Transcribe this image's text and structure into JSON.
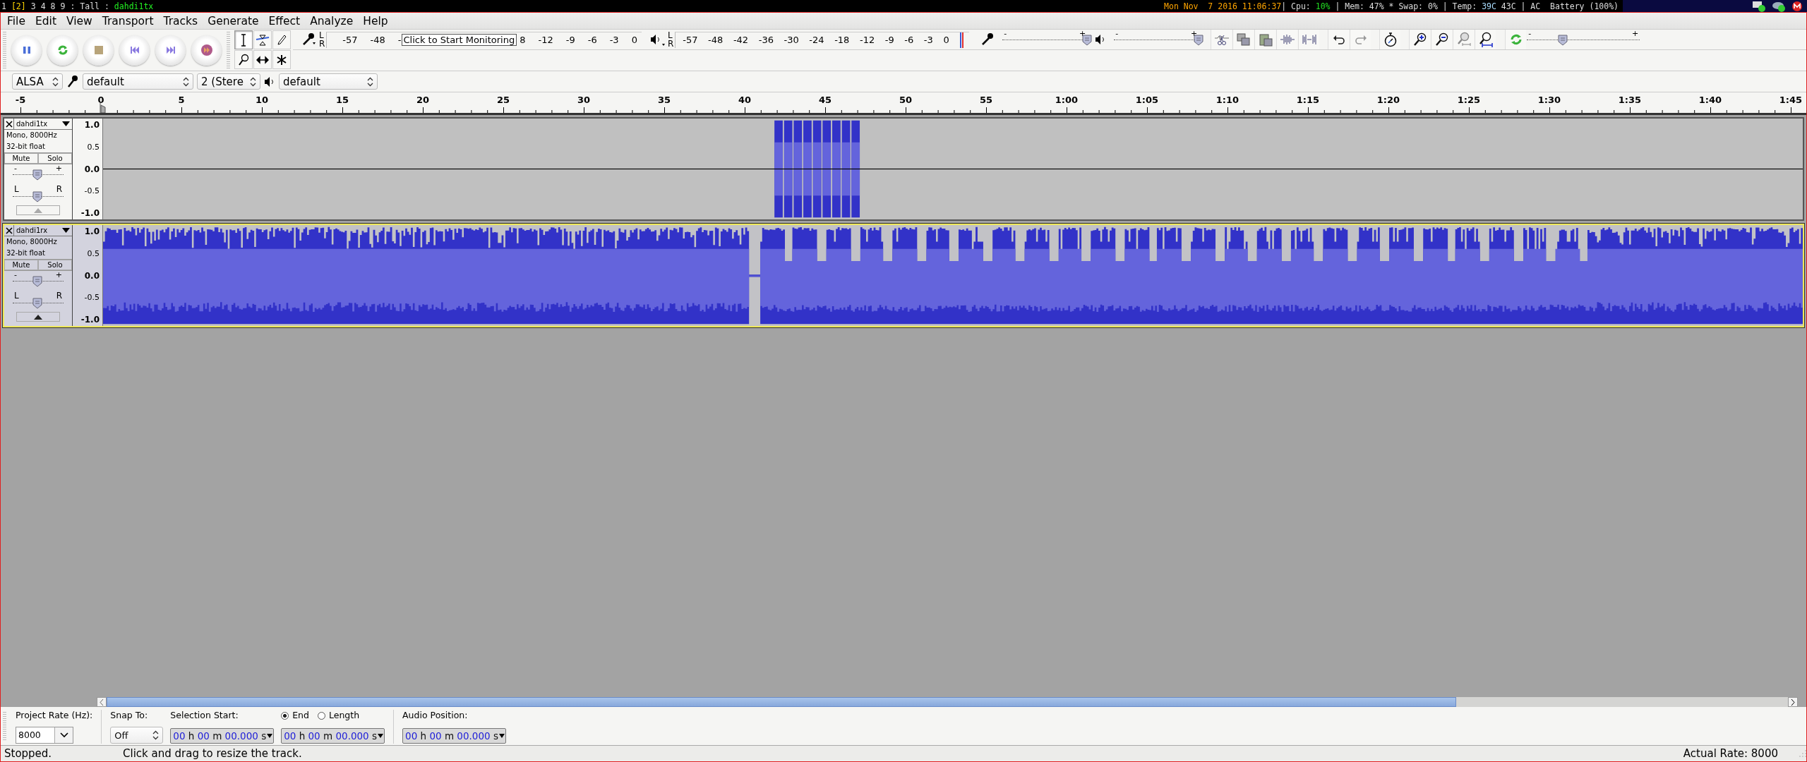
{
  "system_bar": {
    "workspaces": [
      {
        "label": "1",
        "selected": false
      },
      {
        "label": "[2]",
        "selected": true
      },
      {
        "label": "3",
        "selected": false
      },
      {
        "label": "4",
        "selected": false
      },
      {
        "label": "8",
        "selected": false
      },
      {
        "label": "9",
        "selected": false
      }
    ],
    "layout": ": Tall :",
    "window_title": "dahdi1tx",
    "status": [
      {
        "text": "Mon Nov  7 2016 11:06:37",
        "color": "#ffa500"
      },
      {
        "text": "| Cpu: ",
        "color": "#dddddd"
      },
      {
        "text": "10%",
        "color": "#22dd22"
      },
      {
        "text": " | Mem: 47% * Swap: 0% | Temp: ",
        "color": "#dddddd"
      },
      {
        "text": "39C",
        "color": "#aaddff"
      },
      {
        "text": " 43C | AC  Battery (100%)",
        "color": "#dddddd"
      }
    ]
  },
  "menu": [
    "File",
    "Edit",
    "View",
    "Transport",
    "Tracks",
    "Generate",
    "Effect",
    "Analyze",
    "Help"
  ],
  "tools": [
    {
      "kind": "selection",
      "selected": true
    },
    {
      "kind": "envelope",
      "selected": false
    },
    {
      "kind": "draw",
      "selected": false
    },
    {
      "kind": "zoom",
      "selected": false
    },
    {
      "kind": "timeshift",
      "selected": false
    },
    {
      "kind": "multi",
      "selected": false
    }
  ],
  "record_meter": {
    "channels": [
      "L",
      "R"
    ],
    "ticks_before": [
      "-57",
      "-48",
      "-"
    ],
    "tooltip": "Click to Start Monitoring",
    "ticks_after": [
      "8",
      "-12",
      "-9",
      "-6",
      "-3",
      "0"
    ]
  },
  "playback_meter": {
    "channels": [
      "L",
      "R"
    ],
    "ticks": [
      "-57",
      "-48",
      "-42",
      "-36",
      "-30",
      "-24",
      "-18",
      "-12",
      "-9",
      "-6",
      "-3",
      "0"
    ]
  },
  "mixer": {
    "recording": {
      "min": "-",
      "max": "+",
      "level": 1.0
    },
    "playback": {
      "min": "-",
      "max": "+",
      "level": 1.0
    }
  },
  "play_at_speed": {
    "min": "-",
    "max": "+",
    "level": 0.32
  },
  "devices": {
    "host": "ALSA",
    "input": "default",
    "channels": "2 (Stere",
    "output": "default"
  },
  "ruler": [
    "-5",
    "0",
    "5",
    "10",
    "15",
    "20",
    "25",
    "30",
    "35",
    "40",
    "45",
    "50",
    "55",
    "1:00",
    "1:05",
    "1:10",
    "1:15",
    "1:20",
    "1:25",
    "1:30",
    "1:35",
    "1:40",
    "1:45"
  ],
  "tracks": [
    {
      "name": "dahdi1tx",
      "info": [
        "Mono, 8000Hz",
        "32-bit float"
      ],
      "mute": "Mute",
      "solo": "Solo",
      "selected": false,
      "gain": {
        "min": "-",
        "max": "+",
        "level": 0.48
      },
      "pan": {
        "min": "L",
        "max": "R",
        "level": 0.48
      },
      "scale": [
        "1.0",
        "0.5",
        "0.0",
        "-0.5",
        "-1.0"
      ]
    },
    {
      "name": "dahdi1rx",
      "info": [
        "Mono, 8000Hz",
        "32-bit float"
      ],
      "mute": "Mute",
      "solo": "Solo",
      "selected": true,
      "gain": {
        "min": "-",
        "max": "+",
        "level": 0.48
      },
      "pan": {
        "min": "L",
        "max": "R",
        "level": 0.48
      },
      "scale": [
        "1.0",
        "0.5",
        "0.0",
        "-0.5",
        "-1.0"
      ]
    }
  ],
  "selection_bar": {
    "project_rate": {
      "label": "Project Rate (Hz):",
      "value": "8000"
    },
    "snap": {
      "label": "Snap To:",
      "value": "Off"
    },
    "selection_start": {
      "label": "Selection Start:",
      "value": "00 h 00 m 00.000 s"
    },
    "end_mode": [
      {
        "label": "End",
        "selected": true
      },
      {
        "label": "Length",
        "selected": false
      }
    ],
    "end_value": "00 h 00 m 00.000 s",
    "audio_position": {
      "label": "Audio Position:",
      "value": "00 h 00 m 00.000 s"
    }
  },
  "status_bar": {
    "state": "Stopped.",
    "message": "Click and drag to resize the track.",
    "rate": "Actual Rate: 8000"
  }
}
